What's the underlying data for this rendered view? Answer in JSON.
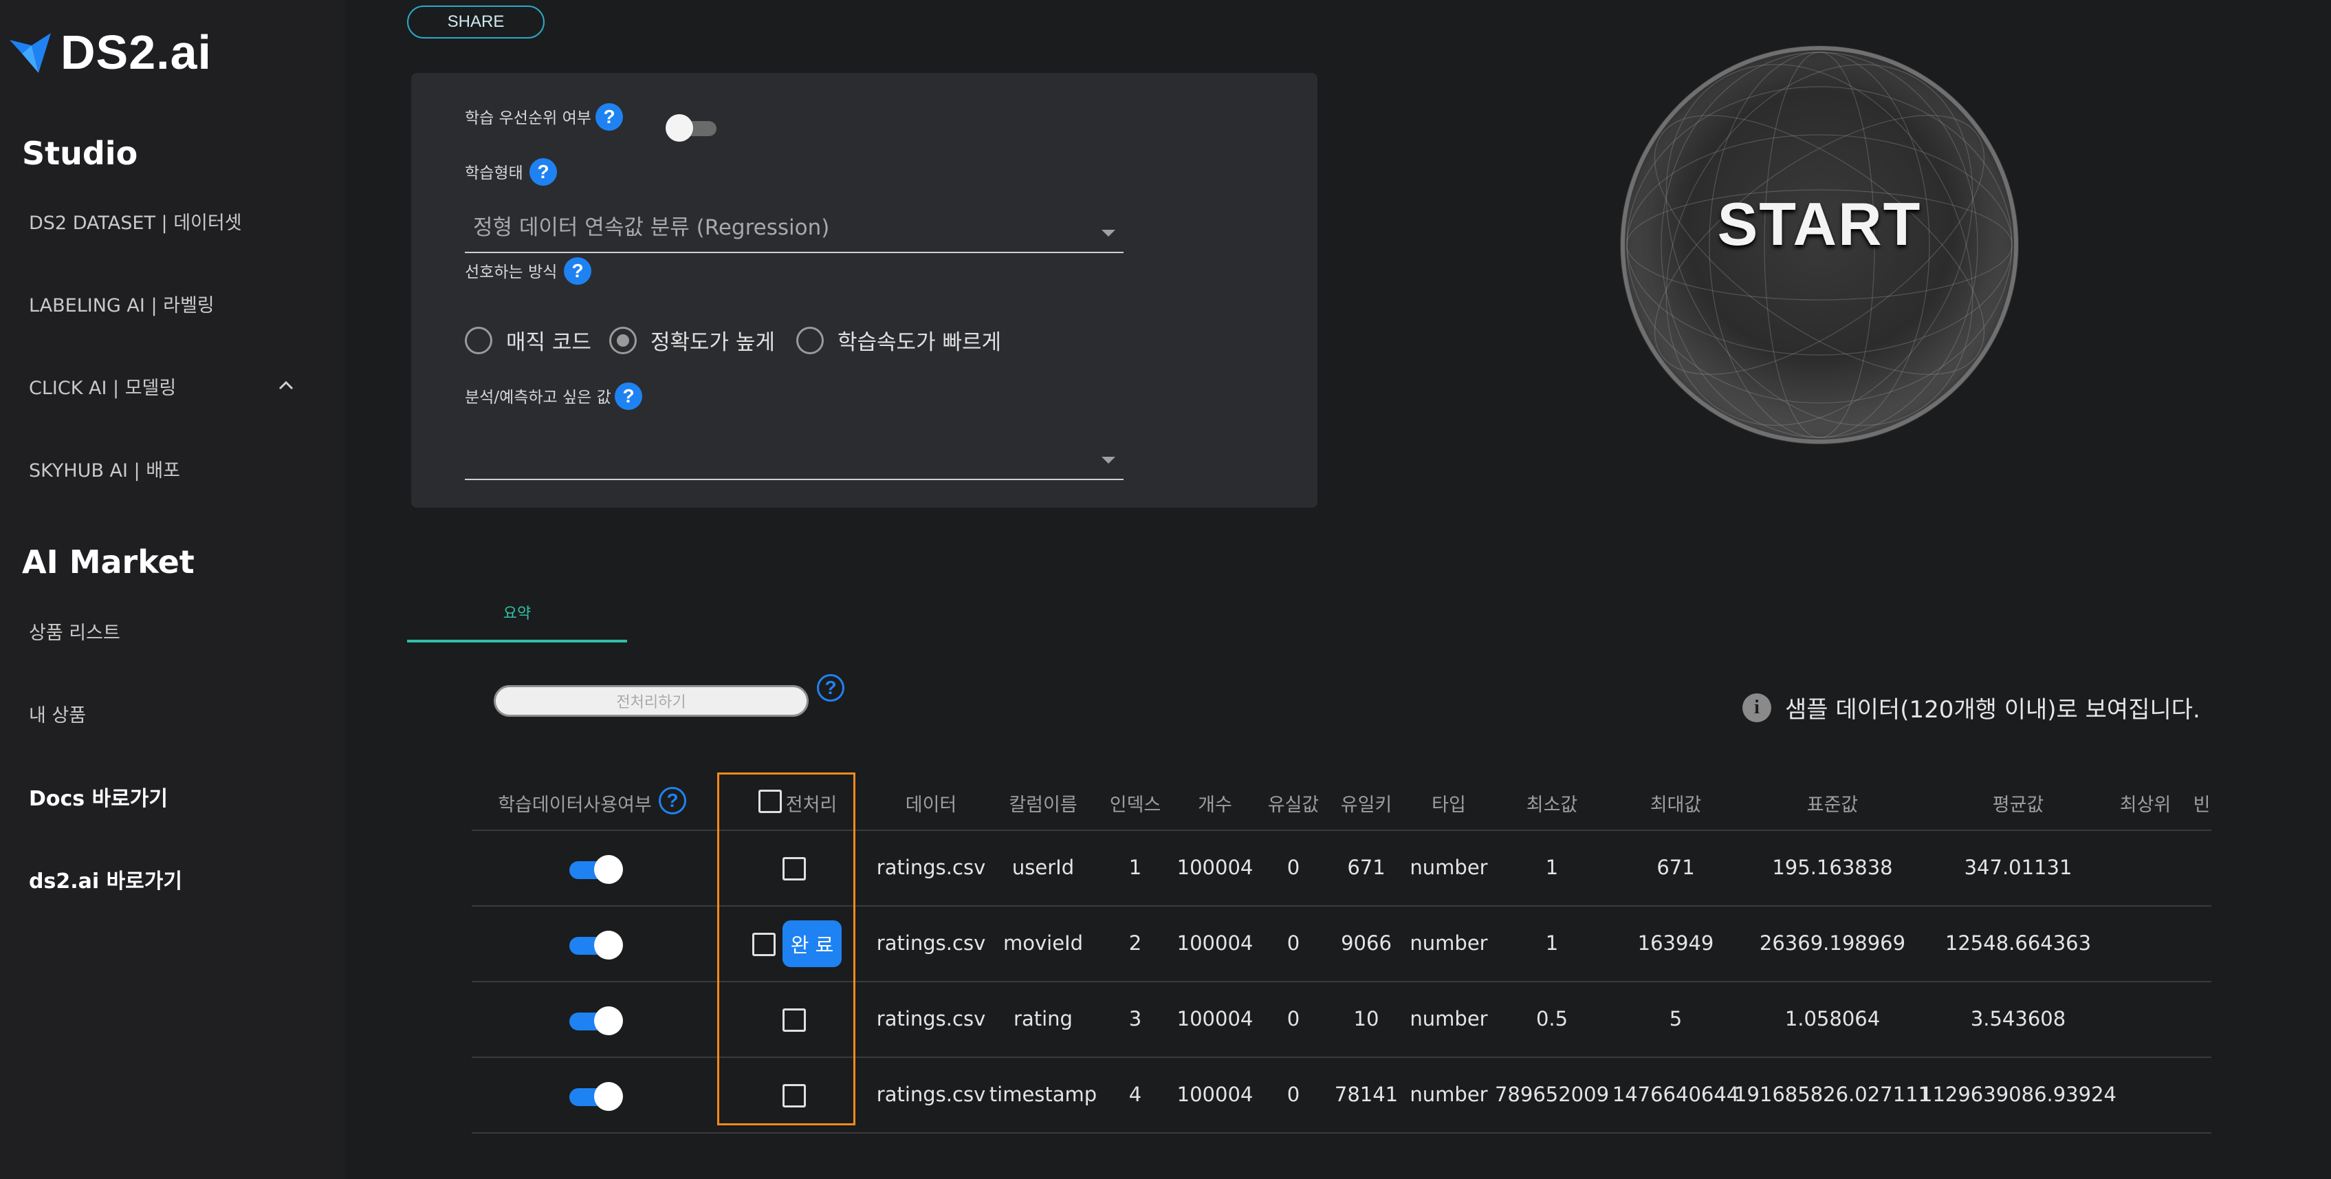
{
  "brand": {
    "name": "DS2.ai"
  },
  "sidebar": {
    "studio_title": "Studio",
    "studio_items": [
      "DS2 DATASET | 데이터셋",
      "LABELING AI | 라벨링",
      "CLICK AI | 모델링",
      "SKYHUB AI | 배포"
    ],
    "market_title": "AI Market",
    "market_items": [
      "상품 리스트",
      "내 상품"
    ],
    "links": [
      "Docs 바로가기",
      "ds2.ai 바로가기"
    ]
  },
  "toolbar": {
    "share_label": "SHARE"
  },
  "settings": {
    "priority_label": "학습 우선순위 여부",
    "priority_on": false,
    "training_type_label": "학습형태",
    "training_type_value": "정형 데이터 연속값 분류 (Regression)",
    "preferred_method_label": "선호하는 방식",
    "methods": [
      "매직 코드",
      "정확도가 높게",
      "학습속도가 빠르게"
    ],
    "selected_method": "정확도가 높게",
    "target_label": "분석/예측하고 싶은 값",
    "target_value": ""
  },
  "start": {
    "label": "START"
  },
  "tabs": {
    "summary": "요약"
  },
  "preprocess": {
    "button_label": "전처리하기"
  },
  "sample_note": "샘플 데이터(120개행 이내)로 보여집니다.",
  "table": {
    "headers": {
      "use": "학습데이터사용여부",
      "preproc": "전처리",
      "data": "데이터",
      "column": "칼럼이름",
      "index": "인덱스",
      "count": "개수",
      "missing": "유실값",
      "unique": "유일키",
      "type": "타입",
      "min": "최소값",
      "max": "최대값",
      "std": "표준값",
      "mean": "평균값",
      "top": "최상위",
      "freq": "빈"
    },
    "done_label": "완 료",
    "rows": [
      {
        "data": "ratings.csv",
        "column": "userId",
        "index": "1",
        "count": "100004",
        "missing": "0",
        "unique": "671",
        "type": "number",
        "min": "1",
        "max": "671",
        "std": "195.163838",
        "mean": "347.01131"
      },
      {
        "data": "ratings.csv",
        "column": "movieId",
        "index": "2",
        "count": "100004",
        "missing": "0",
        "unique": "9066",
        "type": "number",
        "min": "1",
        "max": "163949",
        "std": "26369.198969",
        "mean": "12548.664363"
      },
      {
        "data": "ratings.csv",
        "column": "rating",
        "index": "3",
        "count": "100004",
        "missing": "0",
        "unique": "10",
        "type": "number",
        "min": "0.5",
        "max": "5",
        "std": "1.058064",
        "mean": "3.543608"
      },
      {
        "data": "ratings.csv",
        "column": "timestamp",
        "index": "4",
        "count": "100004",
        "missing": "0",
        "unique": "78141",
        "type": "number",
        "min": "789652009",
        "max": "1476640644",
        "std": "191685826.027111",
        "mean": "1129639086.93924"
      }
    ]
  },
  "colors": {
    "accent": "#1f82f2",
    "tab_accent": "#2fc1a7",
    "highlight": "#f38b1b",
    "share_border": "#2aa9c7"
  }
}
